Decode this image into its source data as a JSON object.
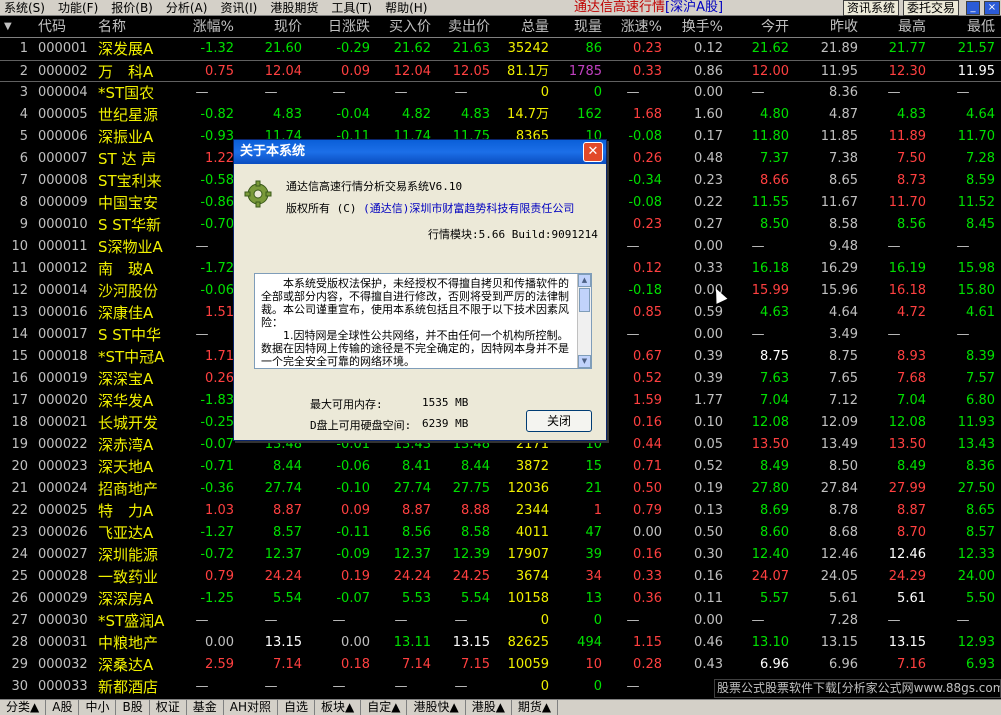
{
  "menu": [
    "系统(S)",
    "功能(F)",
    "报价(B)",
    "分析(A)",
    "资讯(I)",
    "港股期货",
    "工具(T)",
    "帮助(H)"
  ],
  "app_title": "通达信高速行情",
  "market": "[深沪A股]",
  "menu_buttons": [
    "资讯系统",
    "委托交易"
  ],
  "window_buttons": [
    "_",
    "□",
    "×"
  ],
  "columns": [
    "代码",
    "名称",
    "涨幅%",
    "现价",
    "日涨跌",
    "买入价",
    "卖出价",
    "总量",
    "现量",
    "涨速%",
    "换手%",
    "今开",
    "昨收",
    "最高",
    "最低"
  ],
  "rows": [
    {
      "i": "1",
      "code": "000001",
      "name": "深发展A",
      "v": [
        "-1.32",
        "21.60",
        "-0.29",
        "21.62",
        "21.63",
        "35242",
        "86",
        "0.23",
        "0.12",
        "21.62",
        "21.89",
        "21.77",
        "21.57"
      ]
    },
    {
      "i": "2",
      "code": "000002",
      "name": "万　科A",
      "v": [
        "0.75",
        "12.04",
        "0.09",
        "12.04",
        "12.05",
        "81.1万",
        "1785",
        "0.33",
        "0.86",
        "12.00",
        "11.95",
        "12.30",
        "11.95"
      ]
    },
    {
      "i": "3",
      "code": "000004",
      "name": "*ST国农",
      "v": [
        "—",
        "—",
        "—",
        "—",
        "—",
        "0",
        "0",
        "—",
        "0.00",
        "—",
        "8.36",
        "—",
        "—"
      ]
    },
    {
      "i": "4",
      "code": "000005",
      "name": "世纪星源",
      "v": [
        "-0.82",
        "4.83",
        "-0.04",
        "4.82",
        "4.83",
        "14.7万",
        "162",
        "1.68",
        "1.60",
        "4.80",
        "4.87",
        "4.83",
        "4.64"
      ]
    },
    {
      "i": "5",
      "code": "000006",
      "name": "深振业A",
      "v": [
        "-0.93",
        "11.74",
        "-0.11",
        "11.74",
        "11.75",
        "8365",
        "10",
        "-0.08",
        "0.17",
        "11.80",
        "11.85",
        "11.89",
        "11.70"
      ]
    },
    {
      "i": "6",
      "code": "000007",
      "name": "ST 达 声",
      "v": [
        "1.22",
        "",
        "",
        "",
        "",
        "",
        "",
        "0.26",
        "0.48",
        "7.37",
        "7.38",
        "7.50",
        "7.28"
      ]
    },
    {
      "i": "7",
      "code": "000008",
      "name": "ST宝利来",
      "v": [
        "-0.58",
        "",
        "",
        "",
        "",
        "",
        "",
        "-0.34",
        "0.23",
        "8.66",
        "8.65",
        "8.73",
        "8.59"
      ]
    },
    {
      "i": "8",
      "code": "000009",
      "name": "中国宝安",
      "v": [
        "-0.86",
        "",
        "",
        "",
        "",
        "",
        "",
        "-0.08",
        "0.22",
        "11.55",
        "11.67",
        "11.70",
        "11.52"
      ]
    },
    {
      "i": "9",
      "code": "000010",
      "name": "S ST华新",
      "v": [
        "-0.70",
        "",
        "",
        "",
        "",
        "",
        "",
        "0.23",
        "0.27",
        "8.50",
        "8.58",
        "8.56",
        "8.45"
      ]
    },
    {
      "i": "10",
      "code": "000011",
      "name": "S深物业A",
      "v": [
        "—",
        "",
        "",
        "",
        "",
        "",
        "",
        "—",
        "0.00",
        "—",
        "9.48",
        "—",
        "—"
      ]
    },
    {
      "i": "11",
      "code": "000012",
      "name": "南　玻A",
      "v": [
        "-1.72",
        "",
        "",
        "",
        "",
        "",
        "",
        "0.12",
        "0.33",
        "16.18",
        "16.29",
        "16.19",
        "15.98"
      ]
    },
    {
      "i": "12",
      "code": "000014",
      "name": "沙河股份",
      "v": [
        "-0.06",
        "",
        "",
        "",
        "",
        "",
        "",
        "-0.18",
        "0.00",
        "15.99",
        "15.96",
        "16.18",
        "15.80"
      ]
    },
    {
      "i": "13",
      "code": "000016",
      "name": "深康佳A",
      "v": [
        "1.51",
        "",
        "",
        "",
        "",
        "",
        "",
        "0.85",
        "0.59",
        "4.63",
        "4.64",
        "4.72",
        "4.61"
      ]
    },
    {
      "i": "14",
      "code": "000017",
      "name": "S ST中华",
      "v": [
        "—",
        "",
        "",
        "",
        "",
        "",
        "",
        "—",
        "0.00",
        "—",
        "3.49",
        "—",
        "—"
      ]
    },
    {
      "i": "15",
      "code": "000018",
      "name": "*ST中冠A",
      "v": [
        "1.71",
        "",
        "",
        "",
        "",
        "",
        "",
        "0.67",
        "0.39",
        "8.75",
        "8.75",
        "8.93",
        "8.39"
      ]
    },
    {
      "i": "16",
      "code": "000019",
      "name": "深深宝A",
      "v": [
        "0.26",
        "",
        "",
        "",
        "",
        "",
        "",
        "0.52",
        "0.39",
        "7.63",
        "7.65",
        "7.68",
        "7.57"
      ]
    },
    {
      "i": "17",
      "code": "000020",
      "name": "深华发A",
      "v": [
        "-1.83",
        "",
        "",
        "",
        "",
        "",
        "",
        "1.59",
        "1.77",
        "7.04",
        "7.12",
        "7.04",
        "6.80"
      ]
    },
    {
      "i": "18",
      "code": "000021",
      "name": "长城开发",
      "v": [
        "-0.25",
        "",
        "",
        "",
        "",
        "",
        "",
        "0.16",
        "0.10",
        "12.08",
        "12.09",
        "12.08",
        "11.93"
      ]
    },
    {
      "i": "19",
      "code": "000022",
      "name": "深赤湾A",
      "v": [
        "-0.07",
        "13.48",
        "-0.01",
        "13.43",
        "13.48",
        "2171",
        "10",
        "0.44",
        "0.05",
        "13.50",
        "13.49",
        "13.50",
        "13.43"
      ]
    },
    {
      "i": "20",
      "code": "000023",
      "name": "深天地A",
      "v": [
        "-0.71",
        "8.44",
        "-0.06",
        "8.41",
        "8.44",
        "3872",
        "15",
        "0.71",
        "0.52",
        "8.49",
        "8.50",
        "8.49",
        "8.36"
      ]
    },
    {
      "i": "21",
      "code": "000024",
      "name": "招商地产",
      "v": [
        "-0.36",
        "27.74",
        "-0.10",
        "27.74",
        "27.75",
        "12036",
        "21",
        "0.50",
        "0.19",
        "27.80",
        "27.84",
        "27.99",
        "27.50"
      ]
    },
    {
      "i": "22",
      "code": "000025",
      "name": "特　力A",
      "v": [
        "1.03",
        "8.87",
        "0.09",
        "8.87",
        "8.88",
        "2344",
        "1",
        "0.79",
        "0.13",
        "8.69",
        "8.78",
        "8.87",
        "8.65"
      ]
    },
    {
      "i": "23",
      "code": "000026",
      "name": "飞亚达A",
      "v": [
        "-1.27",
        "8.57",
        "-0.11",
        "8.56",
        "8.58",
        "4011",
        "47",
        "0.00",
        "0.50",
        "8.60",
        "8.68",
        "8.70",
        "8.57"
      ]
    },
    {
      "i": "24",
      "code": "000027",
      "name": "深圳能源",
      "v": [
        "-0.72",
        "12.37",
        "-0.09",
        "12.37",
        "12.39",
        "17907",
        "39",
        "0.16",
        "0.30",
        "12.40",
        "12.46",
        "12.46",
        "12.33"
      ]
    },
    {
      "i": "25",
      "code": "000028",
      "name": "一致药业",
      "v": [
        "0.79",
        "24.24",
        "0.19",
        "24.24",
        "24.25",
        "3674",
        "34",
        "0.33",
        "0.16",
        "24.07",
        "24.05",
        "24.29",
        "24.00"
      ]
    },
    {
      "i": "26",
      "code": "000029",
      "name": "深深房A",
      "v": [
        "-1.25",
        "5.54",
        "-0.07",
        "5.53",
        "5.54",
        "10158",
        "13",
        "0.36",
        "0.11",
        "5.57",
        "5.61",
        "5.61",
        "5.50"
      ]
    },
    {
      "i": "27",
      "code": "000030",
      "name": "*ST盛润A",
      "v": [
        "—",
        "—",
        "—",
        "—",
        "—",
        "0",
        "0",
        "—",
        "0.00",
        "—",
        "7.28",
        "—",
        "—"
      ]
    },
    {
      "i": "28",
      "code": "000031",
      "name": "中粮地产",
      "v": [
        "0.00",
        "13.15",
        "0.00",
        "13.11",
        "13.15",
        "82625",
        "494",
        "1.15",
        "0.46",
        "13.10",
        "13.15",
        "13.15",
        "12.93"
      ]
    },
    {
      "i": "29",
      "code": "000032",
      "name": "深桑达A",
      "v": [
        "2.59",
        "7.14",
        "0.18",
        "7.14",
        "7.15",
        "10059",
        "10",
        "0.28",
        "0.43",
        "6.96",
        "6.96",
        "7.16",
        "6.93"
      ]
    },
    {
      "i": "30",
      "code": "000033",
      "name": "新都酒店",
      "v": [
        "—",
        "—",
        "—",
        "—",
        "—",
        "0",
        "0",
        "—",
        "",
        "",
        "",
        "",
        ""
      ]
    }
  ],
  "tabs": [
    "分类▲",
    "A股",
    "中小",
    "B股",
    "权证",
    "基金",
    "AH对照",
    "自选",
    "板块▲",
    "自定▲",
    "港股快▲",
    "港股▲",
    "期货▲"
  ],
  "ad_text": "股票公式股票软件下载[分析家公式网www.88gs.com]",
  "dialog": {
    "title": "关于本系统",
    "product": "通达信高速行情分析交易系统V6.10",
    "copyright_label": "版权所有 (C)",
    "copyright_holder": "(通达信)深圳市财富趋势科技有限责任公司",
    "module_label": "行情模块:5.66 Build:9091214",
    "license_text": "　　本系统受版权法保护，未经授权不得擅自拷贝和传播软件的全部或部分内容，不得擅自进行修改，否则将受到严厉的法律制裁。本公司谨重宣布，使用本系统包括且不限于以下技术因素风险：\n　　1.因特网是全球性公共网络，并不由任何一个机构所控制。数据在因特网上传输的途径是不完全确定的，因特网本身并不是一个完全安全可靠的网络环境。",
    "mem_label": "最大可用内存:",
    "mem_value": "1535 MB",
    "disk_label": "D盘上可用硬盘空间:",
    "disk_value": "6239 MB",
    "close_label": "关闭"
  }
}
